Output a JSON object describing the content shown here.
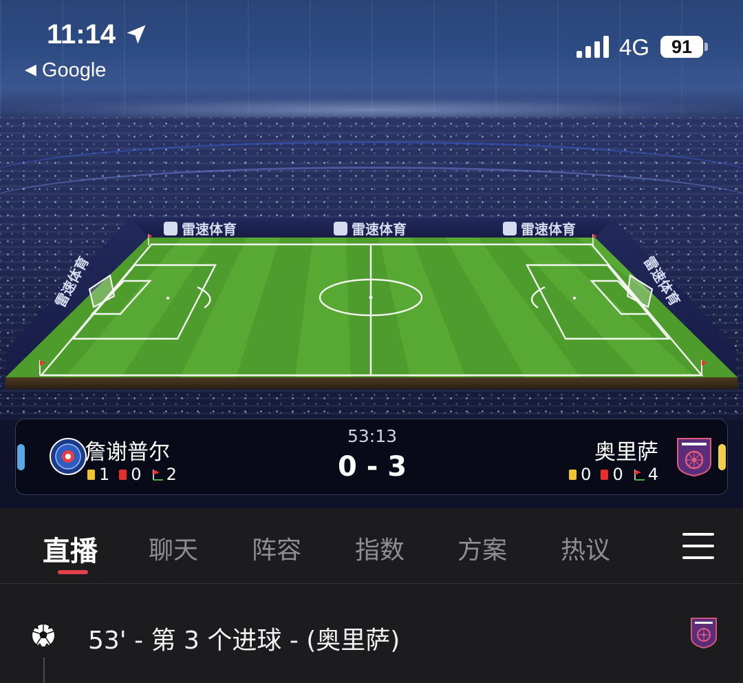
{
  "status_bar": {
    "time": "11:14",
    "back_label": "Google",
    "network": "4G",
    "battery": "91",
    "icons": [
      "location-arrow-icon",
      "signal-bars-icon",
      "battery-icon"
    ]
  },
  "pitch": {
    "ad_board_text": "雷速体育",
    "colors": {
      "grass_light": "#5fb33a",
      "grass_dark": "#4e9e2d"
    }
  },
  "match": {
    "clock": "53:13",
    "score": "0 - 3",
    "home": {
      "name": "詹谢普尔",
      "color": "#5aa9e6",
      "yellow_cards": "1",
      "red_cards": "0",
      "corners": "2",
      "crest_icon": "jamshedpur-crest-icon"
    },
    "away": {
      "name": "奥里萨",
      "color": "#f0cf4e",
      "yellow_cards": "0",
      "red_cards": "0",
      "corners": "4",
      "crest_icon": "odisha-crest-icon"
    }
  },
  "tabs": {
    "items": [
      {
        "label": "直播",
        "active": true
      },
      {
        "label": "聊天"
      },
      {
        "label": "阵容"
      },
      {
        "label": "指数"
      },
      {
        "label": "方案"
      },
      {
        "label": "热议"
      }
    ],
    "accent": "#e0434c"
  },
  "feed": {
    "events": [
      {
        "text": "53' - 第 3 个进球 - (奥里萨)",
        "icon": "soccer-ball-icon",
        "team_icon": "odisha-crest-icon"
      }
    ]
  }
}
